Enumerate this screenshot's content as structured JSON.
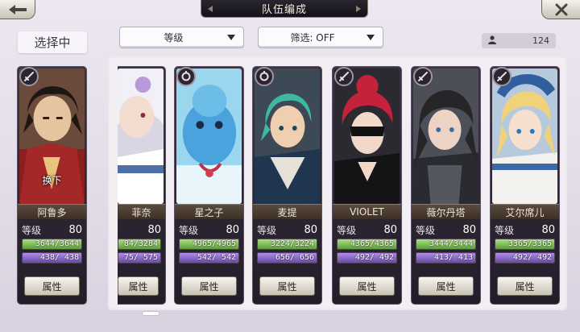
{
  "header": {
    "title": "队伍编成"
  },
  "selected_tab": {
    "label": "选择中"
  },
  "sort_dropdown": {
    "value": "等级"
  },
  "filter_dropdown": {
    "value": "筛选: OFF"
  },
  "member_count": {
    "icon": "person-icon",
    "value": "124"
  },
  "colors": {
    "hp_bar": "#7fc256",
    "mp_bar": "#8a68c8",
    "name_plate": "#4a3d33",
    "card_bg": "#2d2733"
  },
  "cards": [
    {
      "name": "阿鲁多",
      "class_icon": "sword-class-icon",
      "level_label": "等级",
      "level": "80",
      "hp_text": "3644/3644",
      "hp_fraction": 1.0,
      "mp_text": "438/ 438",
      "mp_fraction": 1.0,
      "attr_label": "属性",
      "swap_label": "换下"
    },
    {
      "name": "菲奈",
      "class_icon": "",
      "level_label": "等级",
      "level": "80",
      "hp_text": "84/3284",
      "hp_fraction": 1.0,
      "mp_text": "75/ 575",
      "mp_fraction": 1.0,
      "attr_label": "属性"
    },
    {
      "name": "星之子",
      "class_icon": "magic-class-icon",
      "level_label": "等级",
      "level": "80",
      "hp_text": "4965/4965",
      "hp_fraction": 1.0,
      "mp_text": "542/ 542",
      "mp_fraction": 1.0,
      "attr_label": "属性"
    },
    {
      "name": "麦提",
      "class_icon": "magic-class-icon",
      "level_label": "等级",
      "level": "80",
      "hp_text": "3224/3224",
      "hp_fraction": 1.0,
      "mp_text": "656/ 656",
      "mp_fraction": 1.0,
      "attr_label": "属性"
    },
    {
      "name": "VIOLET",
      "class_icon": "sword-class-icon",
      "level_label": "等级",
      "level": "80",
      "hp_text": "4365/4365",
      "hp_fraction": 1.0,
      "mp_text": "492/ 492",
      "mp_fraction": 1.0,
      "attr_label": "属性"
    },
    {
      "name": "薇尔丹塔",
      "class_icon": "sword-class-icon",
      "level_label": "等级",
      "level": "80",
      "hp_text": "3444/3444",
      "hp_fraction": 1.0,
      "mp_text": "413/ 413",
      "mp_fraction": 1.0,
      "attr_label": "属性"
    },
    {
      "name": "艾尔席儿",
      "class_icon": "sword-class-icon",
      "level_label": "等级",
      "level": "80",
      "hp_text": "3365/3365",
      "hp_fraction": 1.0,
      "mp_text": "492/ 492",
      "mp_fraction": 1.0,
      "attr_label": "属性"
    }
  ]
}
